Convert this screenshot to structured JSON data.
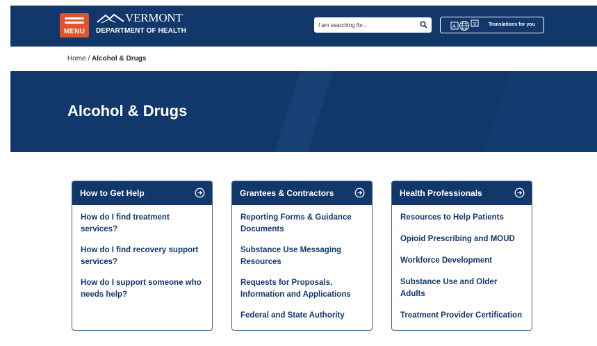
{
  "header": {
    "menu_label": "MENU",
    "logo_state": "VERMONT",
    "logo_dept": "DEPARTMENT OF HEALTH",
    "search_placeholder": "I am searching for...",
    "translate_label": "Translations for you"
  },
  "breadcrumb": {
    "home": "Home",
    "separator": " / ",
    "current": "Alcohol & Drugs"
  },
  "hero": {
    "title": "Alcohol & Drugs"
  },
  "cards": [
    {
      "title": "How to Get Help",
      "links": [
        "How do I find treatment services?",
        "How do I find recovery support services?",
        "How do I support someone who needs help?"
      ]
    },
    {
      "title": "Grantees & Contractors",
      "links": [
        "Reporting Forms & Guidance Documents",
        "Substance Use Messaging Resources",
        "Requests for Proposals, Information and Applications",
        "Federal and State Authority"
      ]
    },
    {
      "title": "Health Professionals",
      "links": [
        "Resources to Help Patients",
        "Opioid Prescribing and MOUD",
        "Workforce Development",
        "Substance Use and Older Adults",
        "Treatment Provider Certification"
      ]
    }
  ],
  "colors": {
    "navy": "#12386b",
    "menu_orange": "#e0532c",
    "link": "#12386b"
  }
}
